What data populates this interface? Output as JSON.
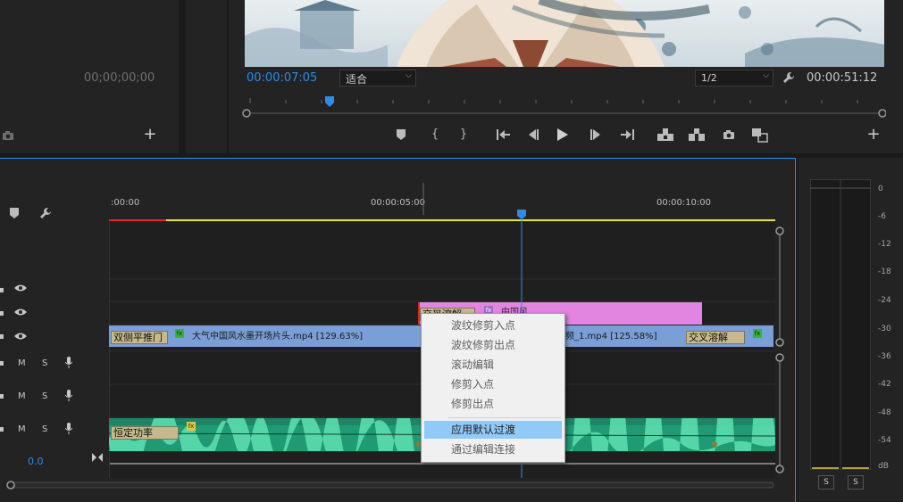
{
  "source": {
    "timecode": "00;00;00;00"
  },
  "program": {
    "current_timecode": "00:00:07:05",
    "fit_select": "适合",
    "resolution_select": "1/2",
    "duration_timecode": "00:00:51:12",
    "playhead_fraction": 0.13
  },
  "timeline": {
    "ruler_labels": [
      ":00:00",
      "00:00:05:00",
      "00:00:10:00"
    ],
    "audio_level_value": "0.0",
    "track_letters": {
      "mute": "M",
      "solo": "S"
    },
    "clips": {
      "v2_label": "中国风",
      "v2_transition": "交叉溶解",
      "v1_left_transition": "双侧平推门",
      "v1_clip_name": "大气中国风水墨开场片头.mp4 [129.63%]",
      "v1_clip2_name": "频_1.mp4 [125.58%]",
      "v1_right_transition": "交叉溶解",
      "a1_transition": "恒定功率",
      "fx_label": "fx"
    }
  },
  "context_menu": {
    "items": [
      {
        "label": "波纹修剪入点",
        "active": false
      },
      {
        "label": "波纹修剪出点",
        "active": false
      },
      {
        "label": "滚动编辑",
        "active": false
      },
      {
        "label": "修剪入点",
        "active": false
      },
      {
        "label": "修剪出点",
        "active": false
      },
      {
        "label": "应用默认过渡",
        "active": true
      },
      {
        "label": "通过编辑连接",
        "active": false
      }
    ]
  },
  "audio_meter": {
    "scale": [
      "0",
      "-6",
      "-12",
      "-18",
      "-24",
      "-30",
      "-36",
      "-42",
      "-48",
      "-54",
      "dB"
    ],
    "solo_buttons": [
      "S",
      "S"
    ]
  },
  "colors": {
    "accent_blue": "#2d8ceb",
    "v2_clip": "#e285e0",
    "v1_clip": "#7a9ed6",
    "audio_clip": "#1f9a73",
    "work_area_yellow": "#e6e33a",
    "menu_highlight": "#91c9f7"
  }
}
